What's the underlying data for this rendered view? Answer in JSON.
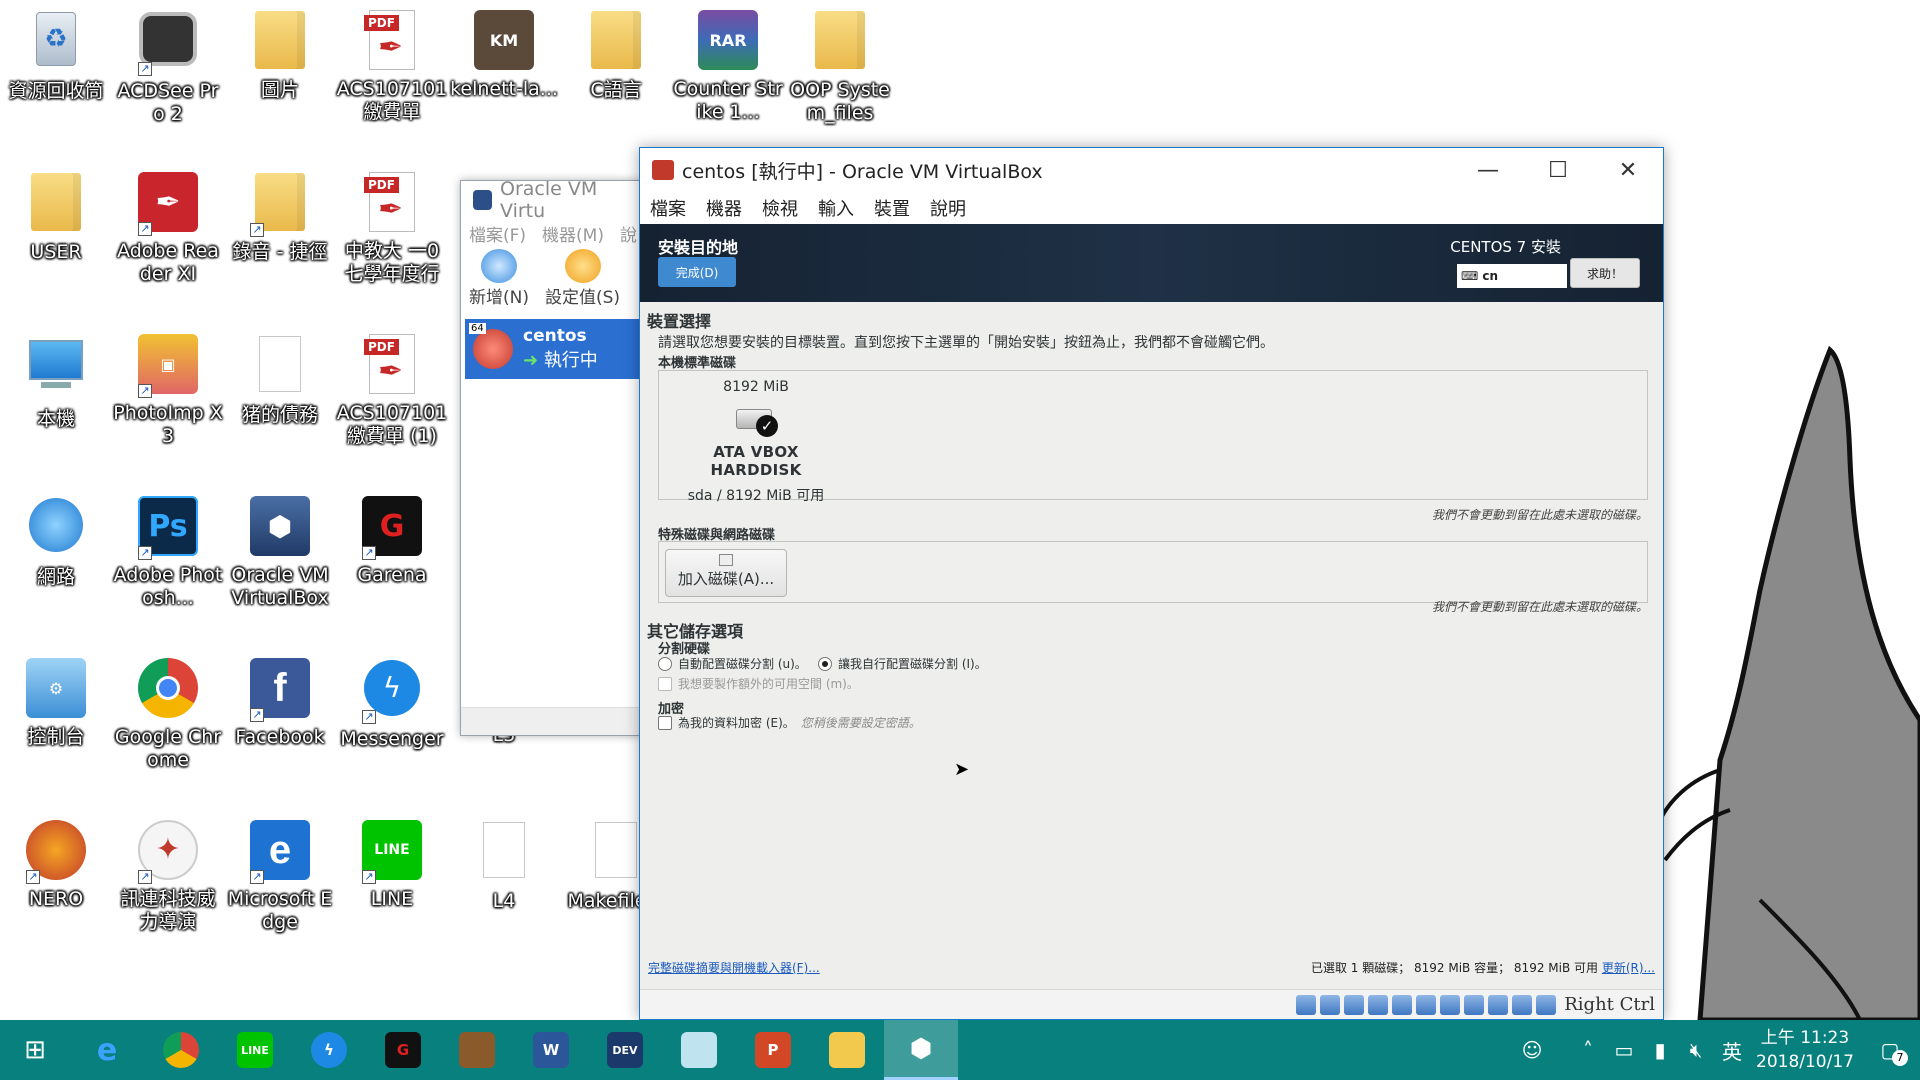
{
  "desktop": {
    "icons": [
      {
        "label": "資源回收筒"
      },
      {
        "label": "ACDSee Pro 2"
      },
      {
        "label": "圖片"
      },
      {
        "label": "ACS107101 繳費單"
      },
      {
        "label": "kelnett-la..."
      },
      {
        "label": "C語言"
      },
      {
        "label": "Counter Strike 1..."
      },
      {
        "label": "OOP System_files"
      },
      {
        "label": "USER"
      },
      {
        "label": "Adobe Reader XI"
      },
      {
        "label": "錄音 - 捷徑"
      },
      {
        "label": "中教大 一0七學年度行"
      },
      {
        "label": "本機"
      },
      {
        "label": "PhotoImp X3"
      },
      {
        "label": "猪的債務"
      },
      {
        "label": "ACS107101 繳費單 (1)"
      },
      {
        "label": "網路"
      },
      {
        "label": "Adobe Photosh..."
      },
      {
        "label": "Oracle VM VirtualBox"
      },
      {
        "label": "Garena"
      },
      {
        "label": "控制台"
      },
      {
        "label": "Google Chrome"
      },
      {
        "label": "Facebook"
      },
      {
        "label": "Messenger"
      },
      {
        "label": "L3"
      },
      {
        "label": "NERO"
      },
      {
        "label": "訊連科技威力導演"
      },
      {
        "label": "Microsoft Edge"
      },
      {
        "label": "LINE"
      },
      {
        "label": "L4"
      },
      {
        "label": "Makefile..."
      }
    ]
  },
  "manager": {
    "title": "Oracle VM Virtu",
    "menu": [
      "檔案(F)",
      "機器(M)",
      "說"
    ],
    "tools": [
      "新增(N)",
      "設定值(S)"
    ],
    "vm": {
      "badge": "64",
      "name": "centos",
      "state": "執行中"
    }
  },
  "vmwindow": {
    "title": "centos [執行中] - Oracle VM VirtualBox",
    "menu": [
      "檔案",
      "機器",
      "檢視",
      "輸入",
      "裝置",
      "說明"
    ],
    "header": {
      "section": "安裝目的地",
      "done": "完成(D)",
      "product": "CENTOS 7 安裝",
      "keyboard": "cn",
      "help": "求助！"
    },
    "body": {
      "device_selection": "裝置選擇",
      "intro": "請選取您想要安裝的目標裝置。直到您按下主選單的「開始安裝」按鈕為止，我們都不會碰觸它們。",
      "local_disks": "本機標準磁碟",
      "disk": {
        "size": "8192 MiB",
        "model": "ATA VBOX HARDDISK",
        "free": "sda  /  8192 MiB 可用"
      },
      "note1": "我們不會更動到留在此處未選取的磁碟。",
      "special_disks": "特殊磁碟與網路磁碟",
      "add_disk": "加入磁碟(A)...",
      "note2": "我們不會更動到留在此處未選取的磁碟。",
      "other_options": "其它儲存選項",
      "partitioning": "分割硬碟",
      "auto_partition": "自動配置磁碟分割 (u)。",
      "manual_partition": "讓我自行配置磁碟分割 (I)。",
      "extra_space": "我想要製作額外的可用空間 (m)。",
      "encryption": "加密",
      "encrypt_label": "為我的資料加密 (E)。",
      "encrypt_hint": "您稍後需要設定密語。",
      "summary_link": "完整磁碟摘要與開機載入器(F)...",
      "summary_text": "已選取 1 顆磁碟； 8192 MiB 容量； 8192 MiB 可用",
      "refresh": "更新(R)..."
    },
    "statusbar": {
      "host_key": "Right Ctrl"
    }
  },
  "taskbar": {
    "apps": [
      "start-icon",
      "ie-icon",
      "chrome-icon",
      "line-icon",
      "messenger-icon",
      "garena-icon",
      "game-icon",
      "word-icon",
      "devcpp-icon",
      "notepad-icon",
      "powerpoint-icon",
      "explorer-icon",
      "virtualbox-icon"
    ],
    "ime": "英",
    "time": "上午 11:23",
    "date": "2018/10/17",
    "notifications": "7"
  }
}
